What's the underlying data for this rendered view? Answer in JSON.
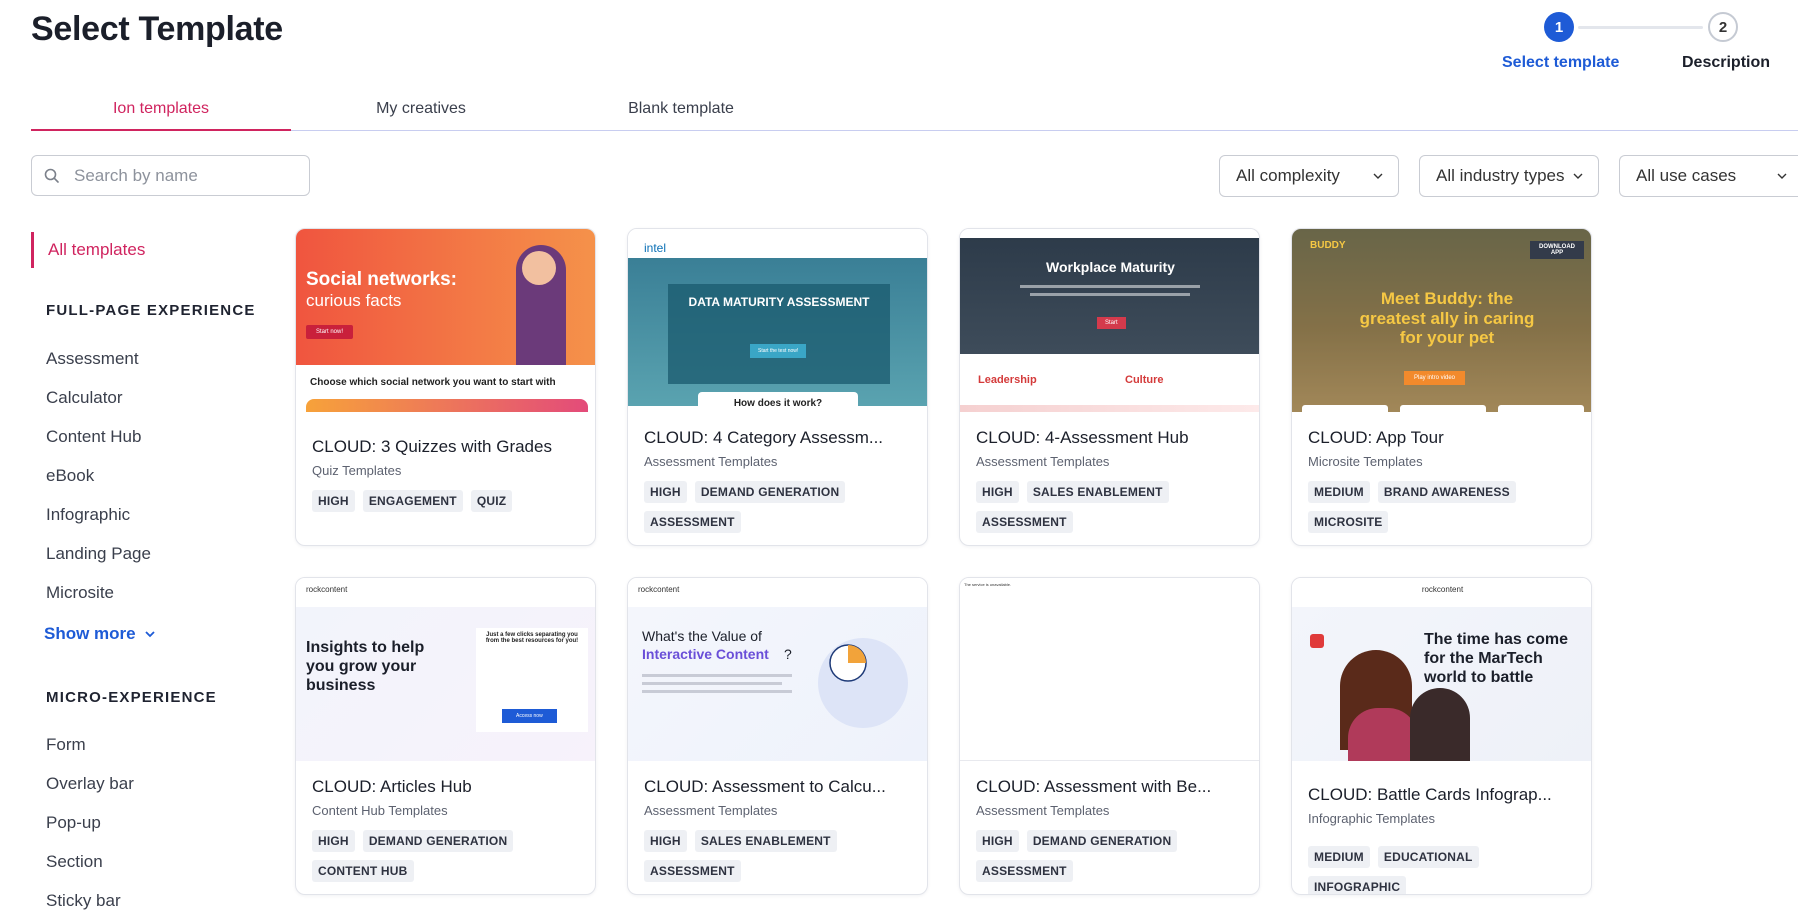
{
  "page": {
    "title": "Select Template"
  },
  "stepper": {
    "steps": [
      {
        "number": "1",
        "label": "Select template"
      },
      {
        "number": "2",
        "label": "Description"
      }
    ]
  },
  "tabs": [
    {
      "label": "Ion templates"
    },
    {
      "label": "My creatives"
    },
    {
      "label": "Blank template"
    }
  ],
  "search": {
    "placeholder": "Search by name"
  },
  "filters": [
    {
      "label": "All complexity"
    },
    {
      "label": "All industry types"
    },
    {
      "label": "All use cases"
    }
  ],
  "sidebar": {
    "all_label": "All templates",
    "full_page_heading": "FULL-PAGE EXPERIENCE",
    "full_page_items": [
      "Assessment",
      "Calculator",
      "Content Hub",
      "eBook",
      "Infographic",
      "Landing Page",
      "Microsite"
    ],
    "show_more": "Show more",
    "micro_heading": "MICRO-EXPERIENCE",
    "micro_items": [
      "Form",
      "Overlay bar",
      "Pop-up",
      "Section",
      "Sticky bar"
    ]
  },
  "cards": [
    {
      "title": "CLOUD: 3 Quizzes with Grades",
      "subtitle": "Quiz Templates",
      "tags": [
        "HIGH",
        "ENGAGEMENT",
        "QUIZ"
      ],
      "thumb": {
        "headline": "Social networks:",
        "headline2": "curious facts",
        "cta": "Start now!",
        "footer": "Choose which social network you want to start with",
        "brand_color": "#f06a3c"
      }
    },
    {
      "title": "CLOUD: 4 Category Assessm...",
      "subtitle": "Assessment Templates",
      "tags": [
        "HIGH",
        "DEMAND GENERATION",
        "ASSESSMENT"
      ],
      "thumb": {
        "logo": "intel",
        "headline": "DATA MATURITY ASSESSMENT",
        "cta": "Start the test now!",
        "footer": "How does it work?"
      }
    },
    {
      "title": "CLOUD: 4-Assessment Hub",
      "subtitle": "Assessment Templates",
      "tags": [
        "HIGH",
        "SALES ENABLEMENT",
        "ASSESSMENT"
      ],
      "thumb": {
        "headline": "Workplace Maturity",
        "cta": "Start",
        "col1": "Leadership",
        "col2": "Culture"
      }
    },
    {
      "title": "CLOUD: App Tour",
      "subtitle": "Microsite Templates",
      "tags": [
        "MEDIUM",
        "BRAND AWARENESS",
        "MICROSITE"
      ],
      "thumb": {
        "logo": "BUDDY",
        "download": "DOWNLOAD APP",
        "headline": "Meet Buddy: the greatest ally in caring for your pet",
        "cta": "Play intro video"
      }
    },
    {
      "title": "CLOUD: Articles Hub",
      "subtitle": "Content Hub Templates",
      "tags": [
        "HIGH",
        "DEMAND GENERATION",
        "CONTENT HUB"
      ],
      "thumb": {
        "logo": "rockcontent",
        "headline": "Insights to help you grow your business",
        "form_title": "Just a few clicks separating you from the best resources for you!",
        "cta": "Access now"
      }
    },
    {
      "title": "CLOUD: Assessment to Calcu...",
      "subtitle": "Assessment Templates",
      "tags": [
        "HIGH",
        "SALES ENABLEMENT",
        "ASSESSMENT"
      ],
      "thumb": {
        "logo": "rockcontent",
        "headline": "What's the Value of",
        "headline2": "Interactive Content",
        "headline3": "?"
      }
    },
    {
      "title": "CLOUD: Assessment with Be...",
      "subtitle": "Assessment Templates",
      "tags": [
        "HIGH",
        "DEMAND GENERATION",
        "ASSESSMENT"
      ],
      "thumb": {
        "note": "The service is unavailable."
      }
    },
    {
      "title": "CLOUD: Battle Cards Infograp...",
      "subtitle": "Infographic Templates",
      "tags": [
        "MEDIUM",
        "EDUCATIONAL",
        "INFOGRAPHIC"
      ],
      "thumb": {
        "logo": "rockcontent",
        "headline": "The time has come for the MarTech world to battle"
      }
    }
  ]
}
